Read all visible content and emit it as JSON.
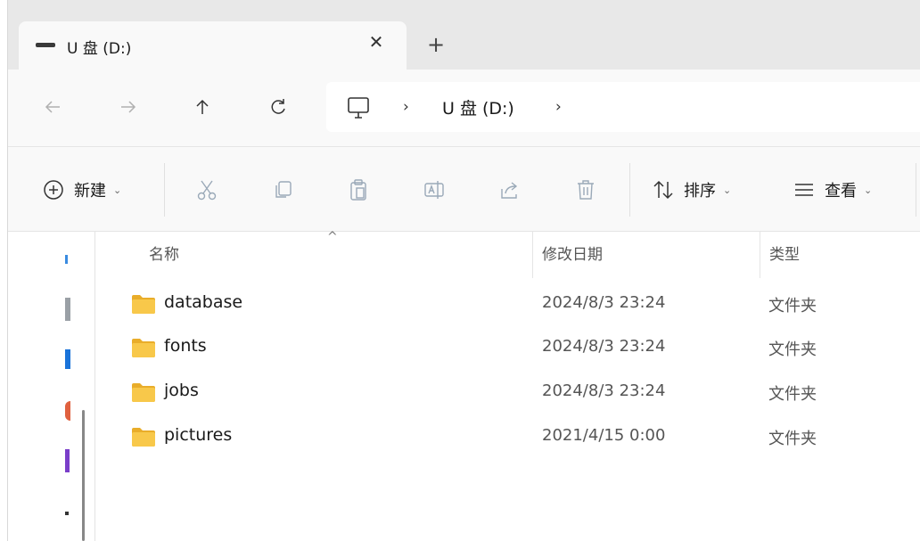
{
  "tab": {
    "title": "U 盘 (D:)",
    "close_glyph": "✕",
    "new_tab_glyph": "+"
  },
  "nav": {
    "back_icon": "arrow-left-icon",
    "forward_icon": "arrow-right-icon",
    "up_icon": "arrow-up-icon",
    "refresh_icon": "refresh-icon",
    "address": {
      "root_icon": "this-pc-icon",
      "crumbs": [
        "U 盘 (D:)"
      ],
      "chevron": "›"
    }
  },
  "toolbar": {
    "new_label": "新建",
    "sort_label": "排序",
    "view_label": "查看",
    "caret": "⌄",
    "icons": [
      "cut-icon",
      "copy-icon",
      "paste-icon",
      "rename-icon",
      "share-icon",
      "delete-icon"
    ]
  },
  "columns": {
    "name": "名称",
    "date": "修改日期",
    "type": "类型",
    "sort_glyph": "^"
  },
  "files": [
    {
      "name": "database",
      "date": "2024/8/3 23:24",
      "type": "文件夹"
    },
    {
      "name": "fonts",
      "date": "2024/8/3 23:24",
      "type": "文件夹"
    },
    {
      "name": "jobs",
      "date": "2024/8/3 23:24",
      "type": "文件夹"
    },
    {
      "name": "pictures",
      "date": "2021/4/15 0:00",
      "type": "文件夹"
    }
  ],
  "colors": {
    "accent": "#0067c0",
    "folder": "#f8c84a",
    "folder_dark": "#e9ad2a"
  }
}
